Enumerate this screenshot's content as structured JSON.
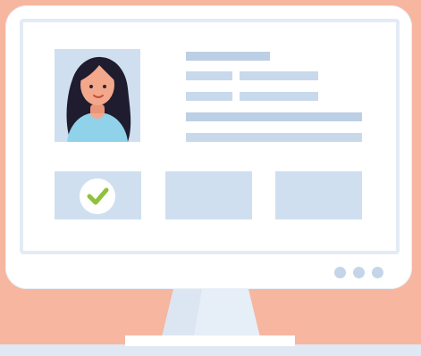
{
  "scene": "profile-card-illustration",
  "colors": {
    "background": "#f6b6a0",
    "monitor": "#ffffff",
    "panel": "#cfdff0",
    "line": "#c8d9ec",
    "check": "#8fc23b",
    "hair": "#1e1c2e",
    "skin": "#f3a78b",
    "shirt": "#8fd2ea"
  },
  "icons": {
    "check": "check-icon",
    "avatar": "woman-avatar-icon"
  },
  "status": {
    "checked": true
  }
}
